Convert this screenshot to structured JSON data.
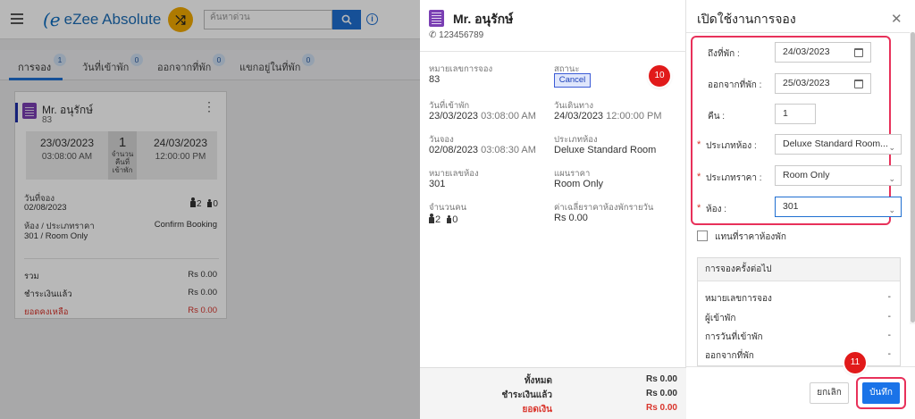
{
  "app": {
    "logo_text": "eZee Absolute",
    "search_placeholder": "ค้นหาด่วน",
    "search_icon": "search-icon",
    "shuffle_icon": "shuffle-icon",
    "info_icon": "info-icon"
  },
  "tabs": [
    {
      "label": "การจอง",
      "count": "1"
    },
    {
      "label": "วันที่เข้าพัก",
      "count": "0"
    },
    {
      "label": "ออกจากที่พัก",
      "count": "0"
    },
    {
      "label": "แขกอยู่ในที่พัก",
      "count": "0"
    }
  ],
  "card": {
    "guest_name": "Mr. อนุรักษ์",
    "booking_id": "83",
    "checkin_date": "23/03/2023",
    "checkin_time": "03:08:00 AM",
    "nights": "1",
    "nights_label_1": "จำนวน",
    "nights_label_2": "คืนที่",
    "nights_label_3": "เข้าพัก",
    "checkout_date": "24/03/2023",
    "checkout_time": "12:00:00 PM",
    "booking_date_label": "วันที่จอง",
    "booking_date": "02/08/2023",
    "adults": "2",
    "children": "0",
    "room_rate_label": "ห้อง / ประเภทราคา",
    "room_rate": "301 / Room Only",
    "status": "Confirm Booking",
    "total_label": "รวม",
    "total": "Rs 0.00",
    "paid_label": "ชำระเงินแล้ว",
    "paid": "Rs 0.00",
    "due_label": "ยอดคงเหลือ",
    "due": "Rs 0.00"
  },
  "detail": {
    "guest_name": "Mr. อนุรักษ์",
    "phone": "123456789",
    "booking_no_label": "หมายเลขการจอง",
    "booking_no": "83",
    "status_label": "สถานะ",
    "status": "Cancel",
    "checkin_label": "วันที่เข้าพัก",
    "checkin_date": "23/03/2023",
    "checkin_time": "03:08:00 AM",
    "checkout_label": "วันเดินทาง",
    "checkout_date": "24/03/2023",
    "checkout_time": "12:00:00 PM",
    "booking_date_label": "วันจอง",
    "booking_date": "02/08/2023",
    "booking_time": "03:08:30 AM",
    "room_type_label": "ประเภทห้อง",
    "room_type": "Deluxe Standard Room",
    "room_no_label": "หมายเลขห้อง",
    "room_no": "301",
    "rate_plan_label": "แผนราคา",
    "rate_plan": "Room Only",
    "pax_label": "จำนวนคน",
    "adults": "2",
    "children": "0",
    "avg_rate_label": "ค่าเฉลี่ยราคาห้องพักรายวัน",
    "avg_rate": "Rs 0.00",
    "step_badge": "10",
    "footer": {
      "total_label": "ทั้งหมด",
      "total": "Rs 0.00",
      "paid_label": "ชำระเงินแล้ว",
      "paid": "Rs 0.00",
      "due_label": "ยอดเงิน",
      "due": "Rs 0.00"
    }
  },
  "form": {
    "title": "เปิดใช้งานการจอง",
    "checkin_label": "ถึงที่พัก :",
    "checkin_value": "24/03/2023",
    "checkout_label": "ออกจากที่พัก :",
    "checkout_value": "25/03/2023",
    "nights_label": "คืน :",
    "nights_value": "1",
    "room_type_label": "ประเภทห้อง :",
    "room_type_value": "Deluxe Standard Room...",
    "rate_type_label": "ประเภทราคา :",
    "rate_type_value": "Room Only",
    "room_label": "ห้อง :",
    "room_value": "301",
    "override_label": "แทนที่ราคาห้องพัก",
    "override_checked": false,
    "next_title": "การจองครั้งต่อไป",
    "next_rows": [
      {
        "label": "หมายเลขการจอง",
        "value": "-"
      },
      {
        "label": "ผู้เข้าพัก",
        "value": "-"
      },
      {
        "label": "การวันที่เข้าพัก",
        "value": "-"
      },
      {
        "label": "ออกจากที่พัก",
        "value": "-"
      }
    ],
    "cancel_label": "ยกเลิก",
    "save_label": "บันทึก",
    "step_badge": "11"
  },
  "colors": {
    "accent": "#1a73e8",
    "highlight": "#e8315a",
    "badge": "#e11a1a",
    "brand_purple": "#7a3fb3"
  }
}
